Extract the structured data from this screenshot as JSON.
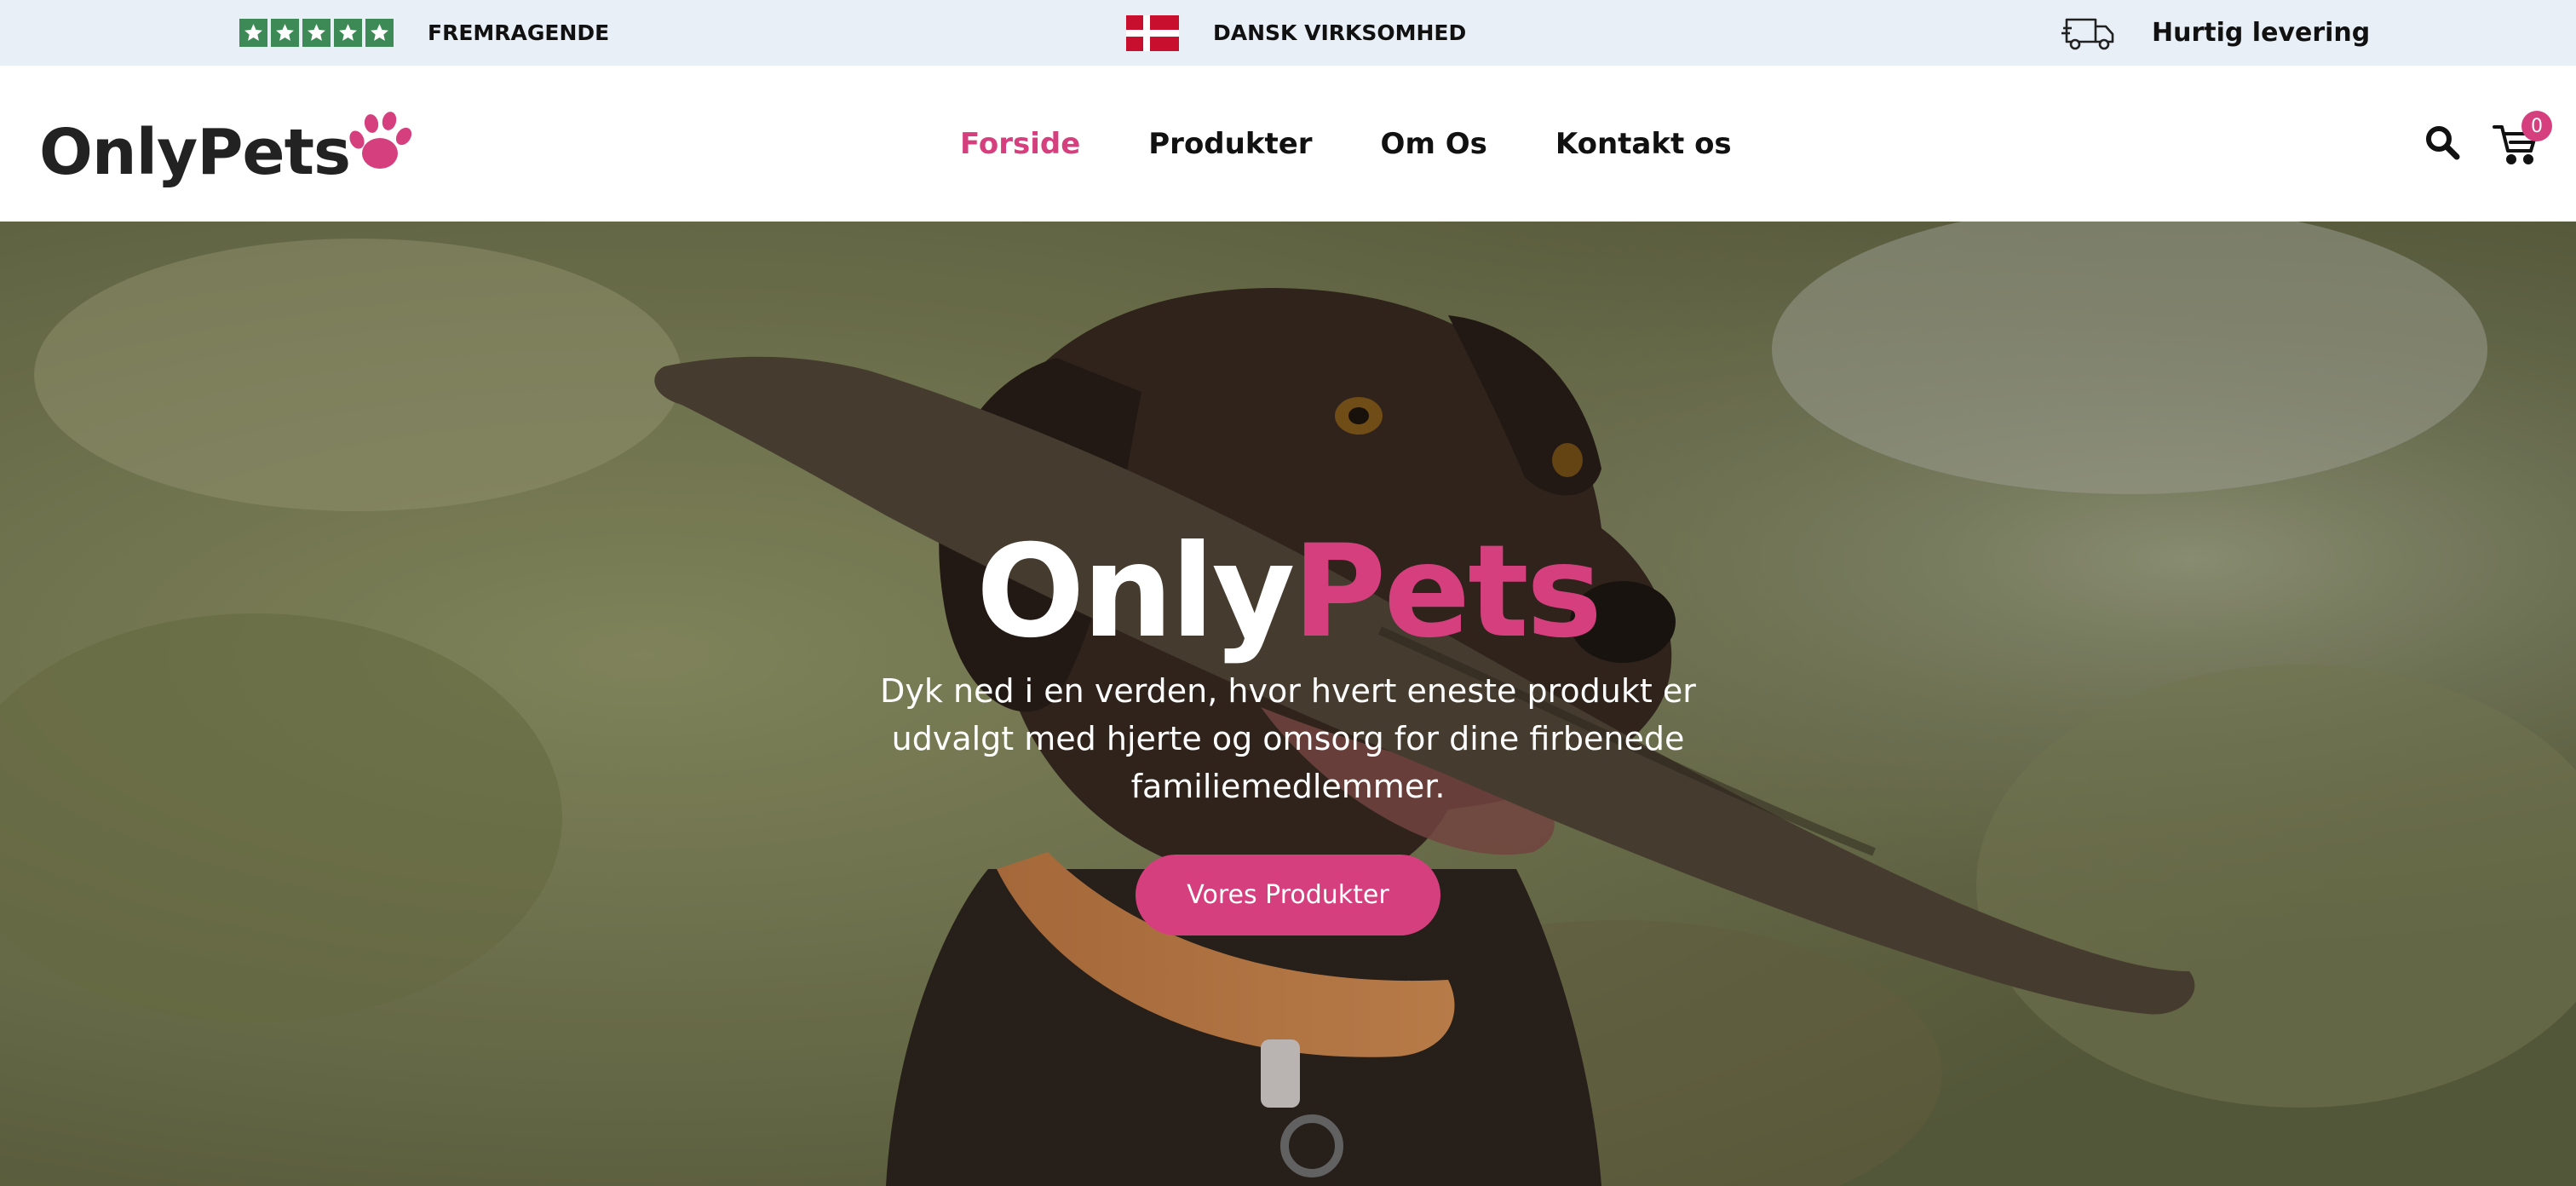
{
  "topbar": {
    "rating_label": "FREMRAGENDE",
    "danish_label": "DANSK VIRKSOMHED",
    "delivery_label": "Hurtig levering",
    "brand_green": "#3d8a56",
    "flag_red": "#c8102e",
    "icons": [
      "star-icon",
      "danish-flag-icon",
      "delivery-truck-icon"
    ]
  },
  "header": {
    "logo_text": "OnlyPets",
    "logo_icon": "paw-icon",
    "nav": [
      {
        "label": "Forside",
        "active": true
      },
      {
        "label": "Produkter",
        "active": false
      },
      {
        "label": "Om Os",
        "active": false
      },
      {
        "label": "Kontakt os",
        "active": false
      }
    ],
    "search_icon": "search-icon",
    "cart_icon": "cart-icon",
    "cart_count": "0"
  },
  "hero": {
    "title_part1": "Only",
    "title_part2": "Pets",
    "subtitle": "Dyk ned i en verden, hvor hvert eneste produkt er udvalgt med hjerte og omsorg for dine firbenede familiemedlemmer.",
    "cta_label": "Vores Produkter",
    "background": "dog-holding-stick-photo"
  },
  "colors": {
    "accent": "#d63f7e",
    "topbar_bg": "#e8eff7",
    "text_dark": "#111111"
  }
}
